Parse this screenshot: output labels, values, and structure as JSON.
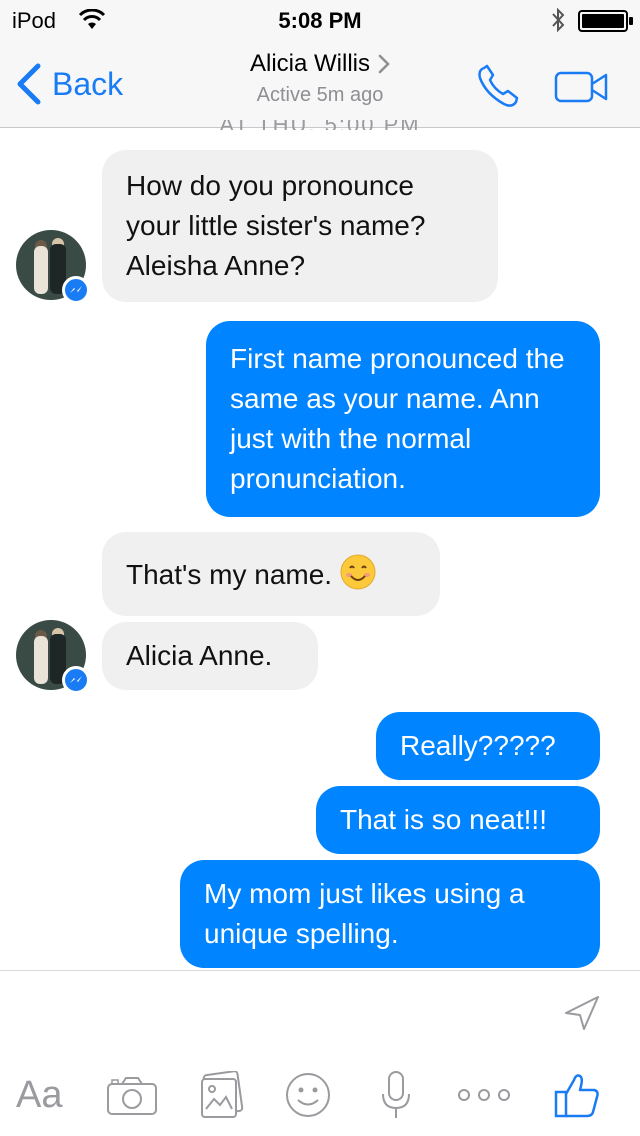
{
  "status": {
    "carrier": "iPod",
    "time": "5:08 PM"
  },
  "nav": {
    "back_label": "Back",
    "contact_name": "Alicia Willis",
    "contact_status": "Active 5m ago"
  },
  "date_peek": "AT THU, 5:00 PM",
  "messages": [
    {
      "from": "them",
      "text": "How do you pronounce your little sister's name? Aleisha Anne?"
    },
    {
      "from": "me",
      "text": "First name pronounced the same as your name. Ann just with the normal pronunciation."
    },
    {
      "from": "them",
      "text": "That's my name."
    },
    {
      "from": "them",
      "text": "Alicia Anne."
    },
    {
      "from": "me",
      "text": "Really?????"
    },
    {
      "from": "me",
      "text": "That is so neat!!!"
    },
    {
      "from": "me",
      "text": "My mom just likes using a unique spelling."
    }
  ],
  "toolbar": {
    "text_label": "Aa"
  },
  "colors": {
    "accent": "#1a7cf5",
    "outgoing": "#0084ff",
    "incoming": "#f0f0f0"
  }
}
